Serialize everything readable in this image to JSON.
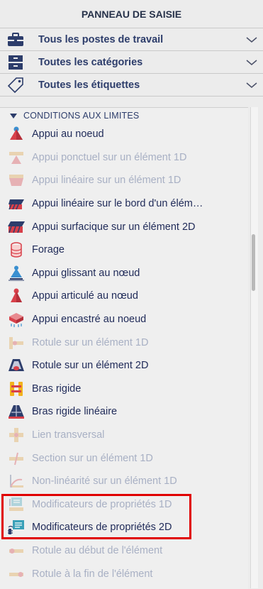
{
  "panel": {
    "title": "PANNEAU DE SAISIE"
  },
  "filters": [
    {
      "label": "Tous les postes de travail",
      "icon": "briefcase-icon"
    },
    {
      "label": "Toutes les catégories",
      "icon": "drawer-icon"
    },
    {
      "label": "Toutes les étiquettes",
      "icon": "tag-icon"
    }
  ],
  "section": {
    "title": "CONDITIONS AUX LIMITES"
  },
  "items": [
    {
      "label": "Appui au noeud",
      "icon": "nodal-support-icon",
      "enabled": true
    },
    {
      "label": "Appui ponctuel sur un élément 1D",
      "icon": "point-support-1d-icon",
      "enabled": false
    },
    {
      "label": "Appui linéaire sur un élément 1D",
      "icon": "line-support-1d-icon",
      "enabled": false
    },
    {
      "label": "Appui linéaire sur le bord d'un élém…",
      "icon": "edge-line-support-icon",
      "enabled": true
    },
    {
      "label": "Appui surfacique sur un élément 2D",
      "icon": "surface-support-2d-icon",
      "enabled": true
    },
    {
      "label": "Forage",
      "icon": "borehole-icon",
      "enabled": true
    },
    {
      "label": "Appui glissant au nœud",
      "icon": "sliding-support-icon",
      "enabled": true
    },
    {
      "label": "Appui articulé au nœud",
      "icon": "hinged-support-icon",
      "enabled": true
    },
    {
      "label": "Appui encastré au noeud",
      "icon": "fixed-support-icon",
      "enabled": true
    },
    {
      "label": "Rotule sur un élément 1D",
      "icon": "hinge-1d-icon",
      "enabled": false
    },
    {
      "label": "Rotule sur un élément 2D",
      "icon": "hinge-2d-icon",
      "enabled": true
    },
    {
      "label": "Bras rigide",
      "icon": "rigid-arm-icon",
      "enabled": true
    },
    {
      "label": "Bras rigide linéaire",
      "icon": "linear-rigid-arm-icon",
      "enabled": true
    },
    {
      "label": "Lien transversal",
      "icon": "cross-link-icon",
      "enabled": false
    },
    {
      "label": "Section sur un élément 1D",
      "icon": "section-1d-icon",
      "enabled": false
    },
    {
      "label": "Non-linéarité sur un élément 1D",
      "icon": "nonlinearity-1d-icon",
      "enabled": false
    },
    {
      "label": "Modificateurs de propriétés 1D",
      "icon": "property-modifier-1d-icon",
      "enabled": false
    },
    {
      "label": "Modificateurs de propriétés 2D",
      "icon": "property-modifier-2d-icon",
      "enabled": true
    },
    {
      "label": "Rotule au début de l'élément",
      "icon": "hinge-start-icon",
      "enabled": false
    },
    {
      "label": "Rotule à la fin de l'élément",
      "icon": "hinge-end-icon",
      "enabled": false
    }
  ],
  "colors": {
    "text_enabled": "#1f2a58",
    "text_disabled": "#a8b0c4",
    "highlight": "#e00000",
    "accent_red": "#d8404a",
    "accent_blue": "#2d3d6b"
  }
}
